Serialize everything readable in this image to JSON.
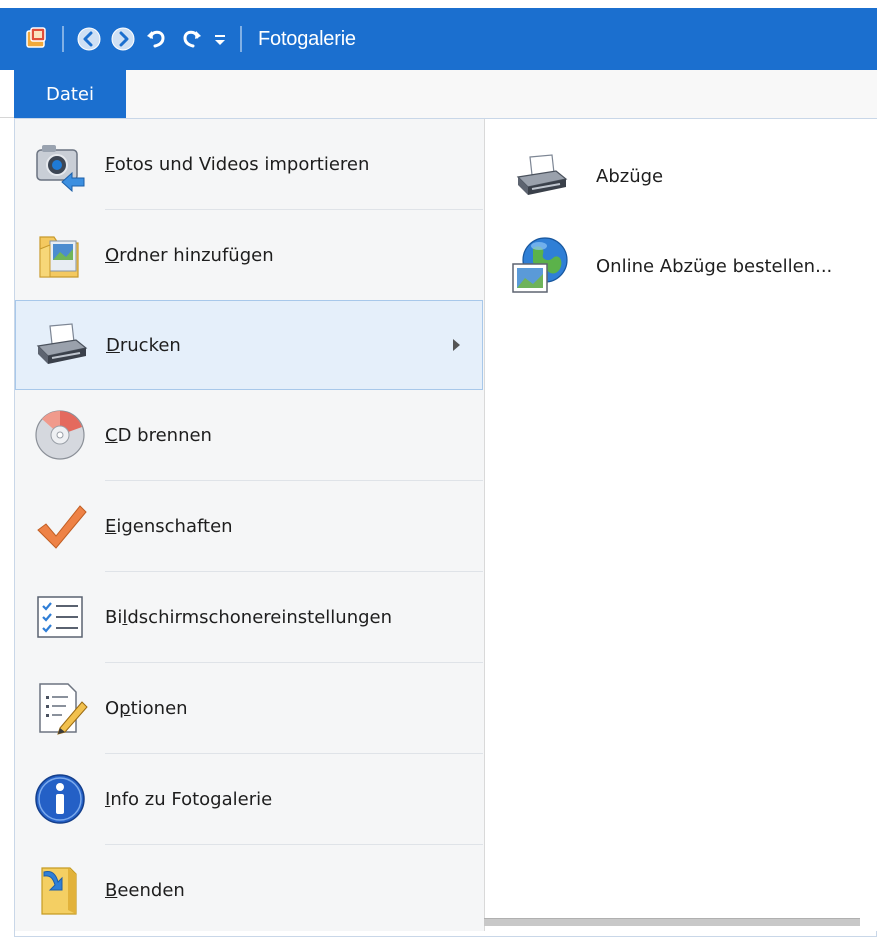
{
  "window": {
    "title": "Fotogalerie",
    "left_edge_char": "s",
    "accent_color": "#1b6fcf"
  },
  "qat": {
    "icons": [
      "app-icon",
      "back-icon",
      "forward-icon",
      "undo-icon",
      "redo-icon",
      "customize-dropdown-icon"
    ]
  },
  "ribbon": {
    "file_tab": "Datei"
  },
  "menu": {
    "items": [
      {
        "label_accel": "F",
        "label_rest": "otos und Videos importieren",
        "icon": "camera-import-icon"
      },
      {
        "label_accel": "O",
        "label_rest": "rdner hinzufügen",
        "icon": "folder-add-icon"
      },
      {
        "label_accel": "D",
        "label_rest": "rucken",
        "icon": "printer-icon",
        "selected": true,
        "has_submenu": true
      },
      {
        "label_accel": "C",
        "label_rest": "D brennen",
        "icon": "cd-burn-icon"
      },
      {
        "label_accel": "E",
        "label_rest": "igenschaften",
        "icon": "checkmark-icon"
      },
      {
        "label_pre": "Bi",
        "label_accel": "l",
        "label_rest": "dschirmschonereinstellungen",
        "icon": "checklist-icon"
      },
      {
        "label_pre": "O",
        "label_accel": "p",
        "label_rest": "tionen",
        "icon": "options-pencil-icon"
      },
      {
        "label_accel": "I",
        "label_rest": "nfo zu Fotogalerie",
        "icon": "info-icon"
      },
      {
        "label_accel": "B",
        "label_rest": "eenden",
        "icon": "exit-icon"
      }
    ]
  },
  "submenu": {
    "items": [
      {
        "label": "Abzüge",
        "icon": "printer-icon"
      },
      {
        "label": "Online Abzüge bestellen...",
        "icon": "globe-photo-icon"
      }
    ]
  }
}
